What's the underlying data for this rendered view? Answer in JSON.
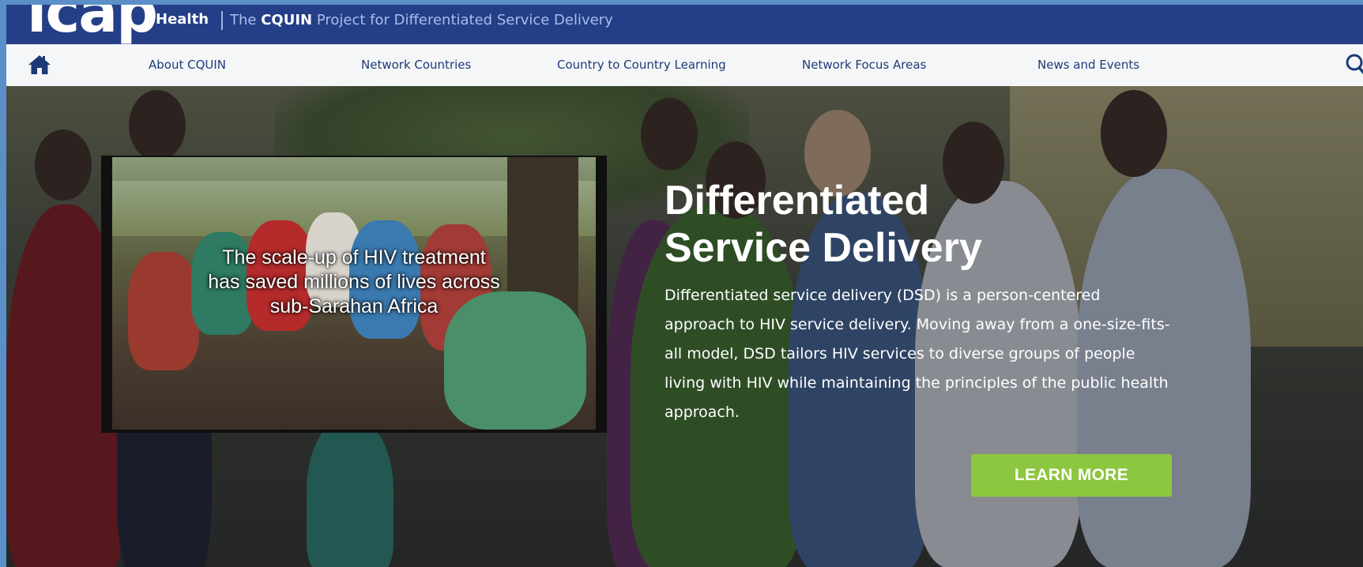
{
  "brand": {
    "logo_text": "icap",
    "logo_sub": "Health",
    "tagline_prefix": "The",
    "tagline_strong": "CQUIN",
    "tagline_rest": "Project for Differentiated Service Delivery"
  },
  "nav": {
    "home_icon": "home-icon",
    "items": [
      {
        "label": "About CQUIN"
      },
      {
        "label": "Network Countries"
      },
      {
        "label": "Country to Country Learning"
      },
      {
        "label": "Network Focus Areas"
      },
      {
        "label": "News and Events"
      }
    ],
    "search_icon": "search-icon"
  },
  "hero": {
    "video_caption": [
      "The scale-up of HIV treatment",
      "has saved millions of lives across",
      "sub-Sarahan Africa"
    ],
    "title_line1": "Differentiated",
    "title_line2": "Service Delivery",
    "body": "Differentiated service delivery (DSD) is a person-centered approach to HIV service delivery. Moving away from a one-size-fits-all model, DSD tailors HIV services to diverse groups of people living with HIV while maintaining the principles of the public health approach.",
    "cta_label": "LEARN MORE"
  },
  "colors": {
    "brand_blue": "#243f87",
    "nav_text": "#1d3a78",
    "cta_green": "#8dc63f",
    "nav_bg": "#f5f6f7"
  }
}
